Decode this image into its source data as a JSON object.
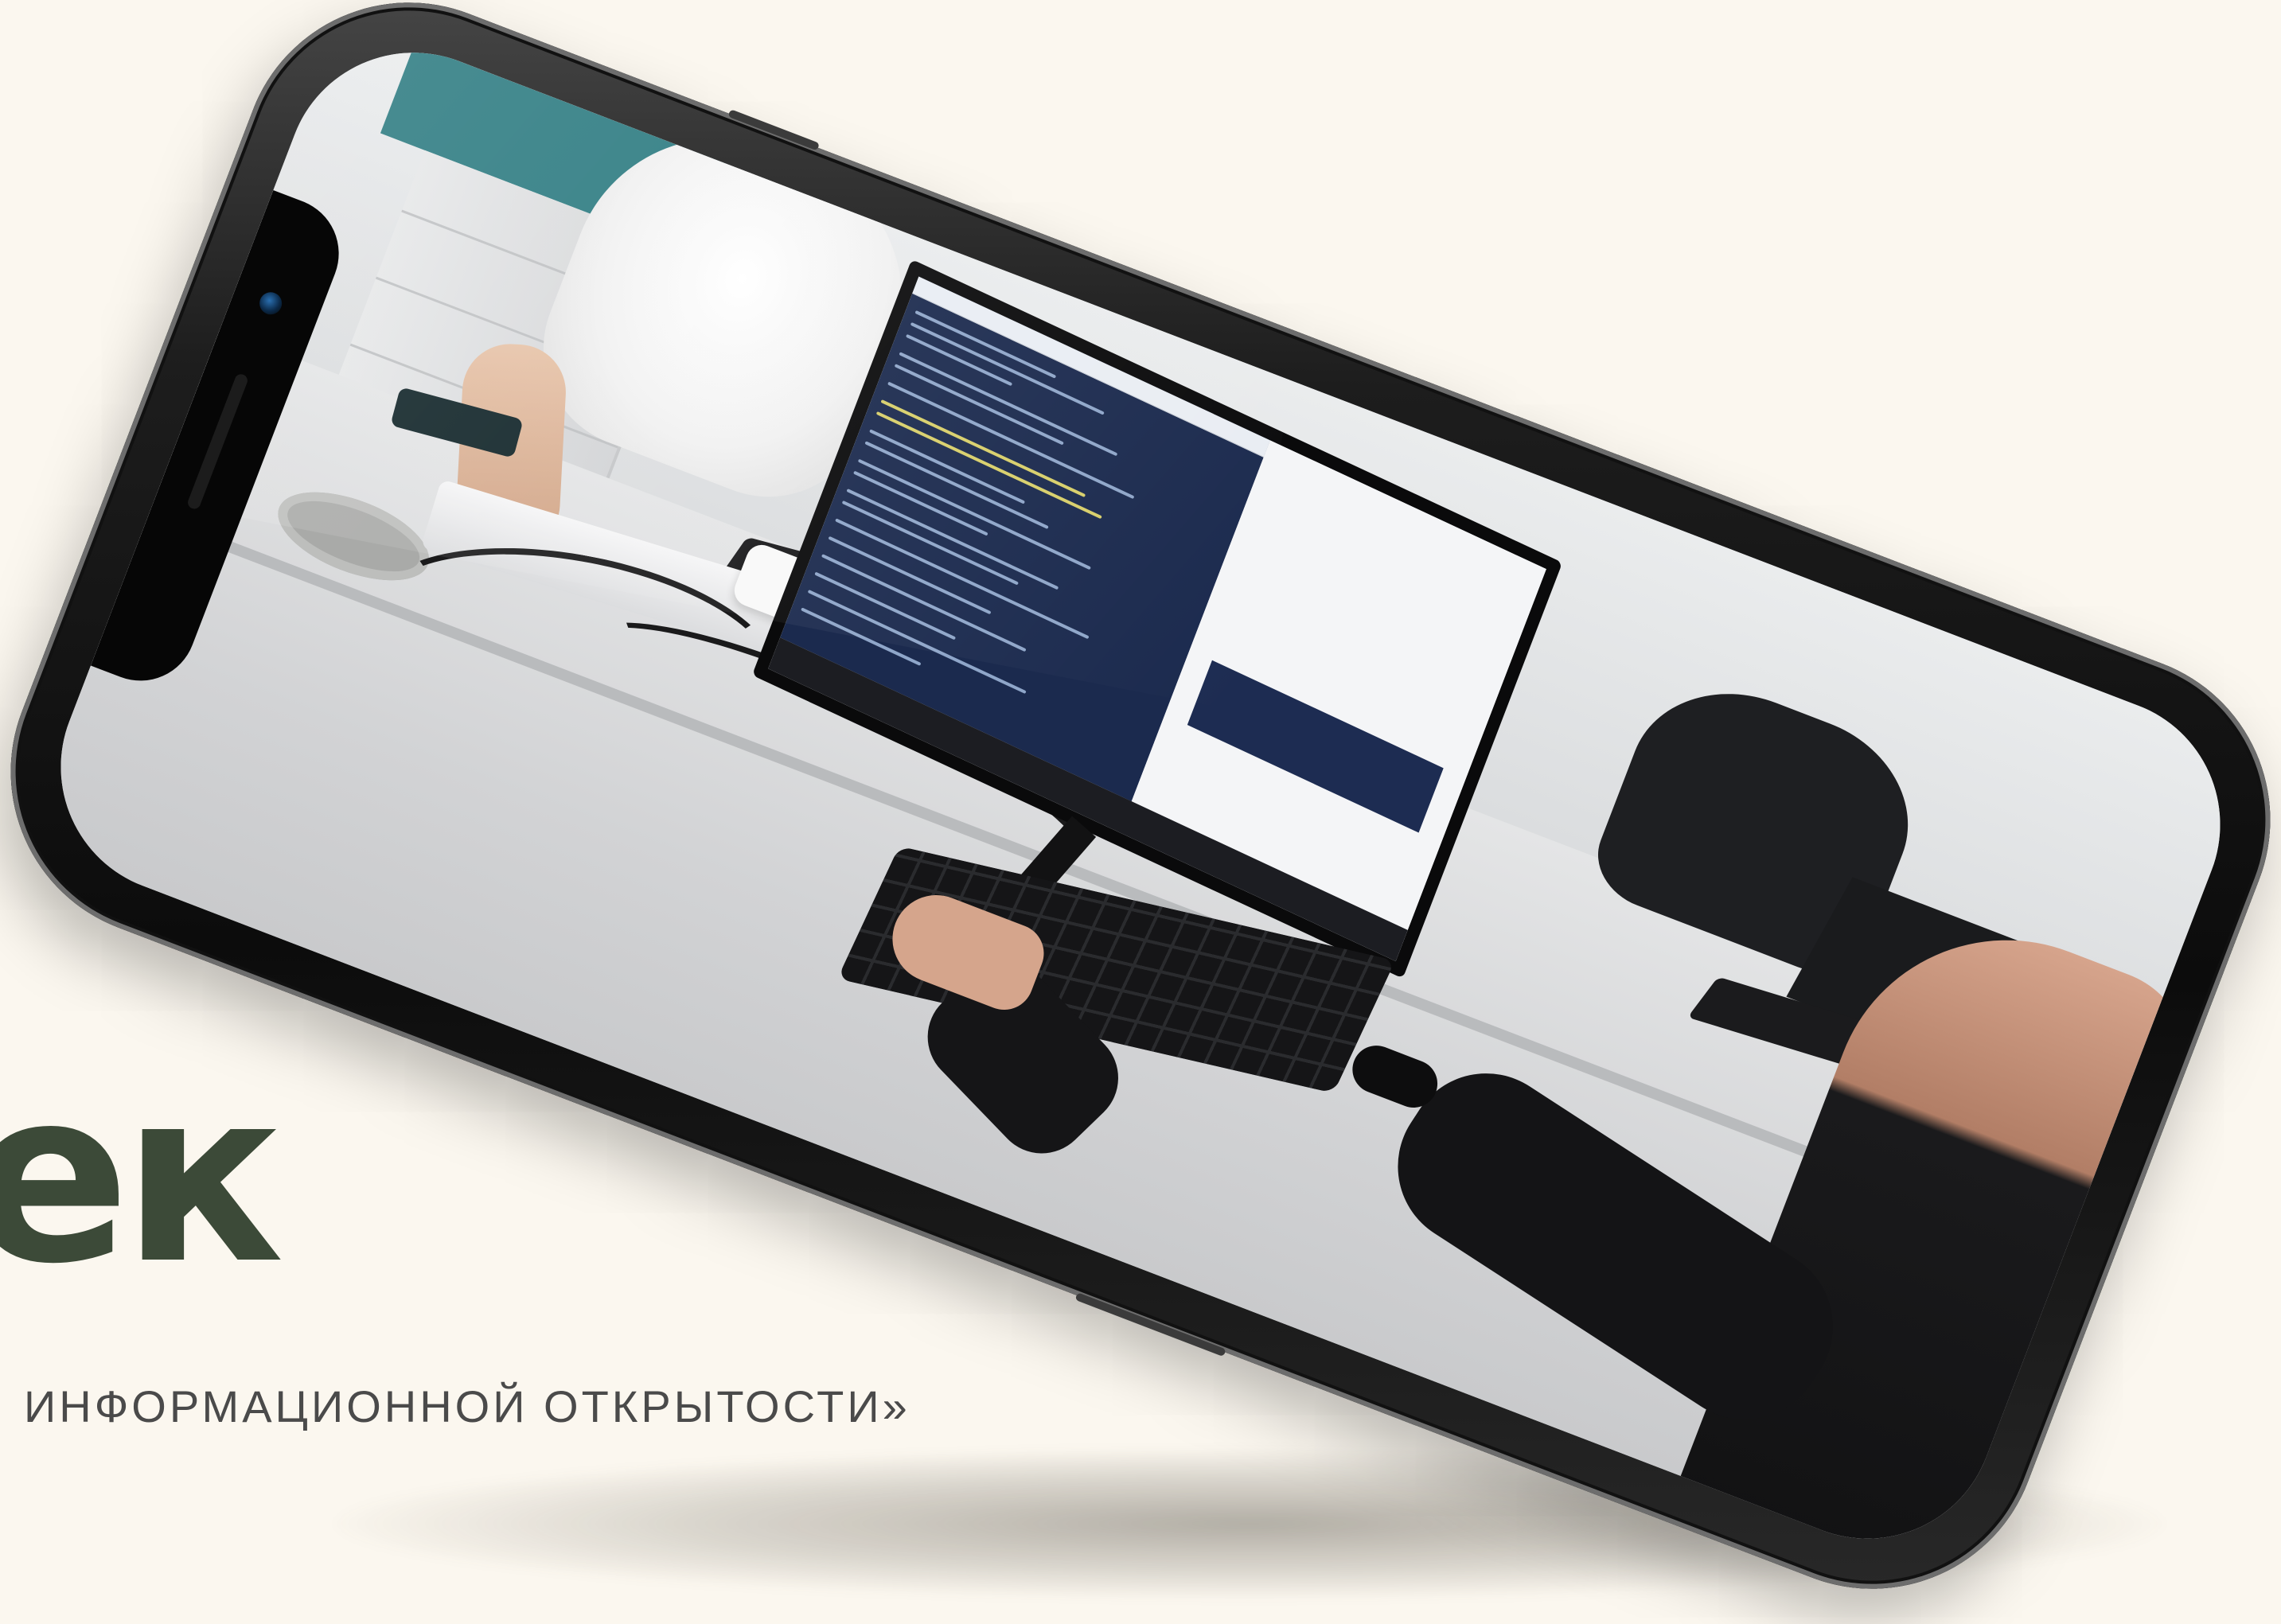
{
  "heading": {
    "word_fragment": "ек",
    "subtitle": "ИНФОРМАЦИОННОЙ ОТКРЫТОСТИ»"
  },
  "colors": {
    "background": "#fbf7ef",
    "heading": "#3c4a38",
    "subtitle": "#4a4a4a",
    "phone_frame": "#0c0c0c"
  },
  "phone": {
    "orientation": "landscape",
    "photo_description_icon": "students-at-computers-photo"
  }
}
